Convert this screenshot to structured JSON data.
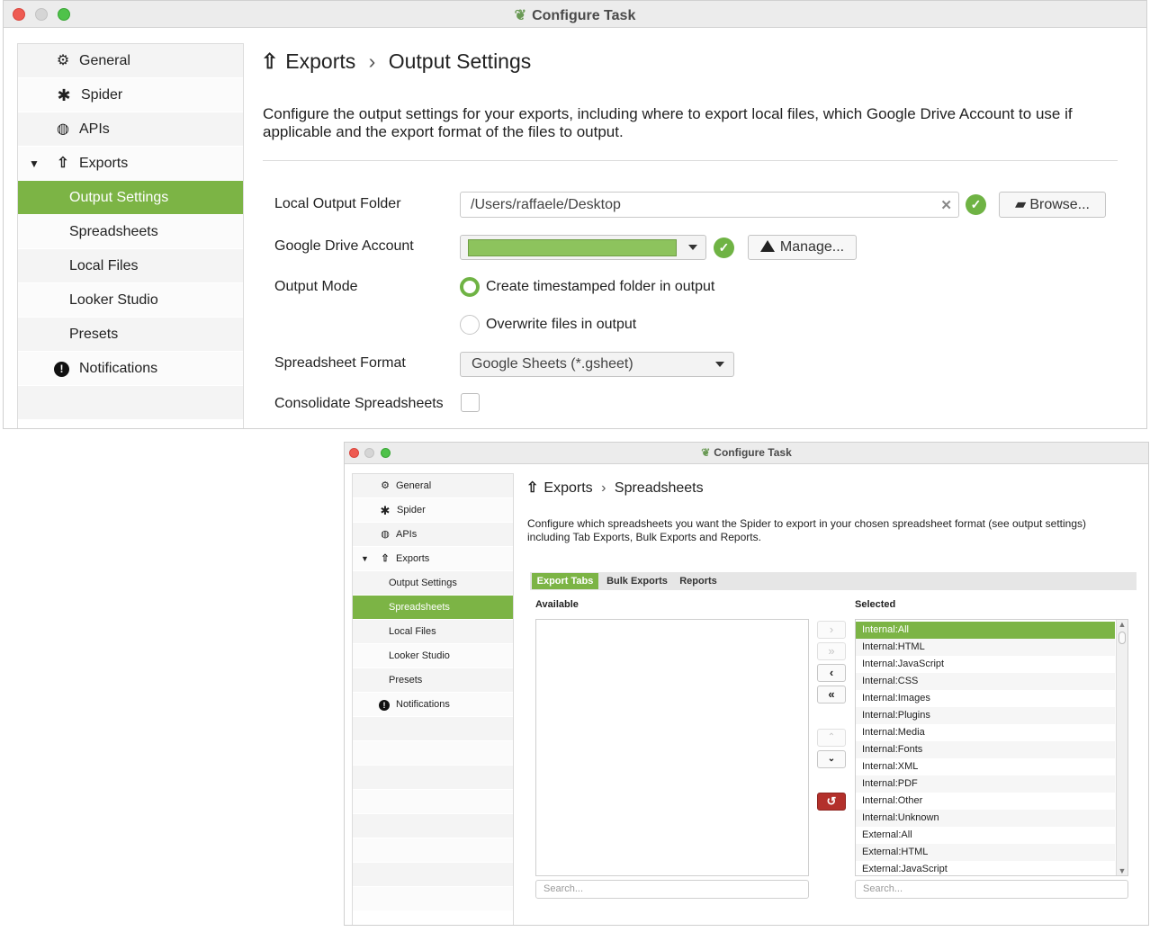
{
  "window1": {
    "title": "Configure Task",
    "sidebar": [
      {
        "label": "General",
        "icon": "gear-icon"
      },
      {
        "label": "Spider",
        "icon": "spider-icon"
      },
      {
        "label": "APIs",
        "icon": "globe-icon"
      },
      {
        "label": "Exports",
        "icon": "upload-icon",
        "expanded": true
      },
      {
        "label": "Output Settings",
        "active": true
      },
      {
        "label": "Spreadsheets"
      },
      {
        "label": "Local Files"
      },
      {
        "label": "Looker Studio"
      },
      {
        "label": "Presets"
      },
      {
        "label": "Notifications",
        "icon": "exclamation-icon"
      }
    ],
    "breadcrumb": {
      "parent": "Exports",
      "separator": "›",
      "current": "Output Settings"
    },
    "description": "Configure the output settings for your exports, including where to export local files, which Google Drive Account to use if applicable and the export format of the files to output.",
    "form": {
      "local_output_folder_label": "Local Output Folder",
      "local_output_folder_value": "/Users/raffaele/Desktop",
      "browse_label": "Browse...",
      "google_drive_account_label": "Google Drive Account",
      "manage_label": "Manage...",
      "output_mode_label": "Output Mode",
      "output_mode_option1": "Create timestamped folder in output",
      "output_mode_option2": "Overwrite files in output",
      "output_mode_selected": "Create timestamped folder in output",
      "spreadsheet_format_label": "Spreadsheet Format",
      "spreadsheet_format_value": "Google Sheets (*.gsheet)",
      "consolidate_label": "Consolidate Spreadsheets",
      "consolidate_checked": false
    }
  },
  "window2": {
    "title": "Configure Task",
    "sidebar": [
      {
        "label": "General",
        "icon": "gear-icon"
      },
      {
        "label": "Spider",
        "icon": "spider-icon"
      },
      {
        "label": "APIs",
        "icon": "globe-icon"
      },
      {
        "label": "Exports",
        "icon": "upload-icon",
        "expanded": true
      },
      {
        "label": "Output Settings"
      },
      {
        "label": "Spreadsheets",
        "active": true
      },
      {
        "label": "Local Files"
      },
      {
        "label": "Looker Studio"
      },
      {
        "label": "Presets"
      },
      {
        "label": "Notifications",
        "icon": "exclamation-icon"
      }
    ],
    "breadcrumb": {
      "parent": "Exports",
      "separator": "›",
      "current": "Spreadsheets"
    },
    "description": "Configure which spreadsheets you want the Spider to export in your chosen spreadsheet format (see output settings) including Tab Exports, Bulk Exports and Reports.",
    "tabs": [
      "Export Tabs",
      "Bulk Exports",
      "Reports"
    ],
    "active_tab": "Export Tabs",
    "available_label": "Available",
    "selected_label": "Selected",
    "available_items": [],
    "selected_items": [
      "Internal:All",
      "Internal:HTML",
      "Internal:JavaScript",
      "Internal:CSS",
      "Internal:Images",
      "Internal:Plugins",
      "Internal:Media",
      "Internal:Fonts",
      "Internal:XML",
      "Internal:PDF",
      "Internal:Other",
      "Internal:Unknown",
      "External:All",
      "External:HTML",
      "External:JavaScript"
    ],
    "selected_highlight": "Internal:All",
    "search_placeholder": "Search..."
  },
  "colors": {
    "accent_green": "#7cb445",
    "reset_red": "#b3302b",
    "close_red": "#ee5b52",
    "zoom_green": "#4fc24a"
  }
}
